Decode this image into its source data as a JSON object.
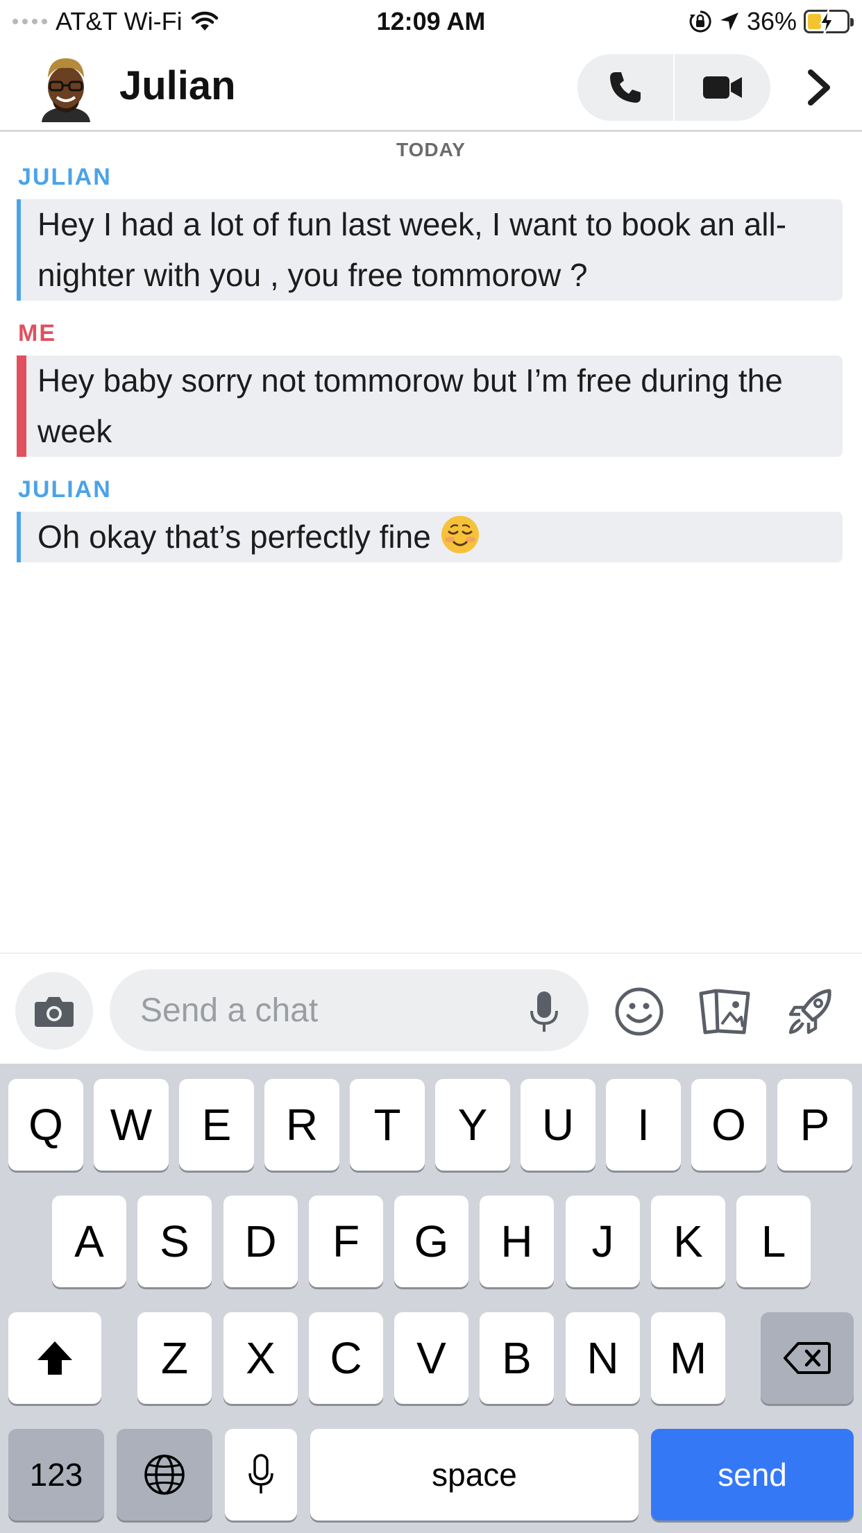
{
  "status_bar": {
    "carrier": "AT&T Wi-Fi",
    "time": "12:09 AM",
    "battery_percent": "36%",
    "battery_level": 0.36,
    "icons": [
      "signal-dots-icon",
      "wifi-icon",
      "orientation-lock-icon",
      "location-arrow-icon",
      "battery-charging-icon"
    ]
  },
  "header": {
    "contact_name": "Julian",
    "icons": [
      "avatar",
      "phone-icon",
      "video-camera-icon",
      "chevron-right-icon"
    ]
  },
  "chat": {
    "date_label": "TODAY",
    "messages": [
      {
        "sender": "JULIAN",
        "text": "Hey I had a lot of fun last week, I want to book an all-nighter with you , you free tommorow ?"
      },
      {
        "sender": "ME",
        "text": "Hey baby sorry not tommorow but I’m free during the week"
      },
      {
        "sender": "JULIAN",
        "text": "Oh okay that’s perfectly fine",
        "emoji": "smiling-blush-emoji"
      }
    ]
  },
  "colors": {
    "julian_accent": "#4aa3e8",
    "me_accent": "#e0505e",
    "send_key": "#3478f6"
  },
  "input": {
    "placeholder": "Send a chat",
    "value": "",
    "icons": [
      "camera-icon",
      "microphone-icon",
      "smiley-icon",
      "cards-icon",
      "rocket-icon"
    ]
  },
  "keyboard": {
    "row1": [
      "Q",
      "W",
      "E",
      "R",
      "T",
      "Y",
      "U",
      "I",
      "O",
      "P"
    ],
    "row2": [
      "A",
      "S",
      "D",
      "F",
      "G",
      "H",
      "J",
      "K",
      "L"
    ],
    "row3": [
      "Z",
      "X",
      "C",
      "V",
      "B",
      "N",
      "M"
    ],
    "numbers_label": "123",
    "space_label": "space",
    "send_label": "send",
    "icons": [
      "shift-icon",
      "backspace-icon",
      "globe-icon",
      "dictation-mic-icon"
    ]
  }
}
